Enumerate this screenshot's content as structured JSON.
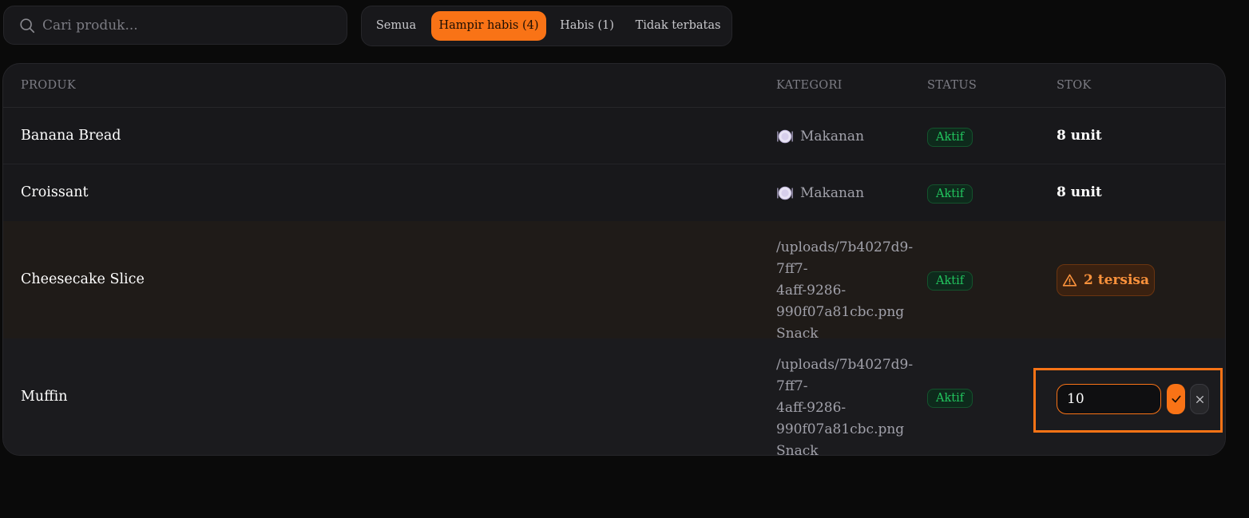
{
  "search": {
    "placeholder": "Cari produk..."
  },
  "filters": {
    "tabs": [
      {
        "label": "Semua",
        "active": false
      },
      {
        "label": "Hampir habis (4)",
        "active": true
      },
      {
        "label": "Habis (1)",
        "active": false
      },
      {
        "label": "Tidak terbatas",
        "active": false
      }
    ]
  },
  "table": {
    "headers": {
      "product": "PRODUK",
      "category": "KATEGORI",
      "status": "STATUS",
      "stock": "STOK"
    },
    "rows": [
      {
        "name": "Banana Bread",
        "category_icon": "plate-icon",
        "category": "Makanan",
        "status": "Aktif",
        "stock": "8 unit"
      },
      {
        "name": "Croissant",
        "category_icon": "plate-icon",
        "category": "Makanan",
        "status": "Aktif",
        "stock": "8 unit"
      },
      {
        "name": "Cheesecake Slice",
        "category_lines": [
          "/uploads/7b4027d9-7ff7-",
          "4aff-9286-",
          "990f07a81cbc.png",
          "Snack"
        ],
        "status": "Aktif",
        "stock_badge": "2 tersisa",
        "stock_icon": "warning-icon"
      },
      {
        "name": "Muffin",
        "category_lines": [
          "/uploads/7b4027d9-7ff7-",
          "4aff-9286-",
          "990f07a81cbc.png",
          "Snack"
        ],
        "status": "Aktif",
        "stock_edit_value": "10"
      }
    ]
  },
  "colors": {
    "accent": "#f97316",
    "success": "#22c55e",
    "background": "#0a0a0a",
    "card": "#18181b"
  }
}
